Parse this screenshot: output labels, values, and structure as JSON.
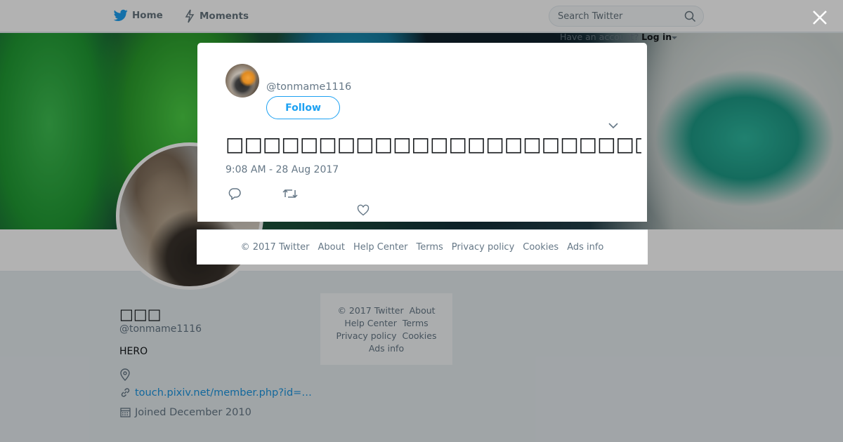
{
  "topbar": {
    "home_label": "Home",
    "moments_label": "Moments",
    "search_placeholder": "Search Twitter",
    "account_prompt": "Have an account?",
    "login_label": "Log in"
  },
  "profile": {
    "name": "□□□",
    "handle": "@tonmame1116",
    "bio": "HERO",
    "url": "touch.pixiv.net/member.php?id=…",
    "joined": "Joined December 2010"
  },
  "side_footer": {
    "copyright": "© 2017 Twitter",
    "about": "About",
    "help": "Help Center",
    "terms": "Terms",
    "privacy": "Privacy policy",
    "cookies": "Cookies",
    "ads": "Ads info"
  },
  "tweet": {
    "handle": "@tonmame1116",
    "follow_label": "Follow",
    "text": "□□□□□□□□□□□□□□□□□□□□□□□□□□□□□□□□□□□□□□□□□",
    "timestamp": "9:08 AM - 28 Aug 2017"
  },
  "modal_footer": {
    "copyright": "© 2017 Twitter",
    "about": "About",
    "help": "Help Center",
    "terms": "Terms",
    "privacy": "Privacy policy",
    "cookies": "Cookies",
    "ads": "Ads info"
  },
  "colors": {
    "accent": "#1da1f2",
    "link": "#1b95e0",
    "muted_text": "#657786",
    "overlay": "rgba(0,0,0,0.3)"
  },
  "icons": [
    "twitter-bird-icon",
    "lightning-icon",
    "search-icon",
    "caret-down-icon",
    "close-icon",
    "location-icon",
    "link-icon",
    "calendar-icon",
    "reply-icon",
    "retweet-icon",
    "like-icon",
    "chevron-down-icon"
  ]
}
